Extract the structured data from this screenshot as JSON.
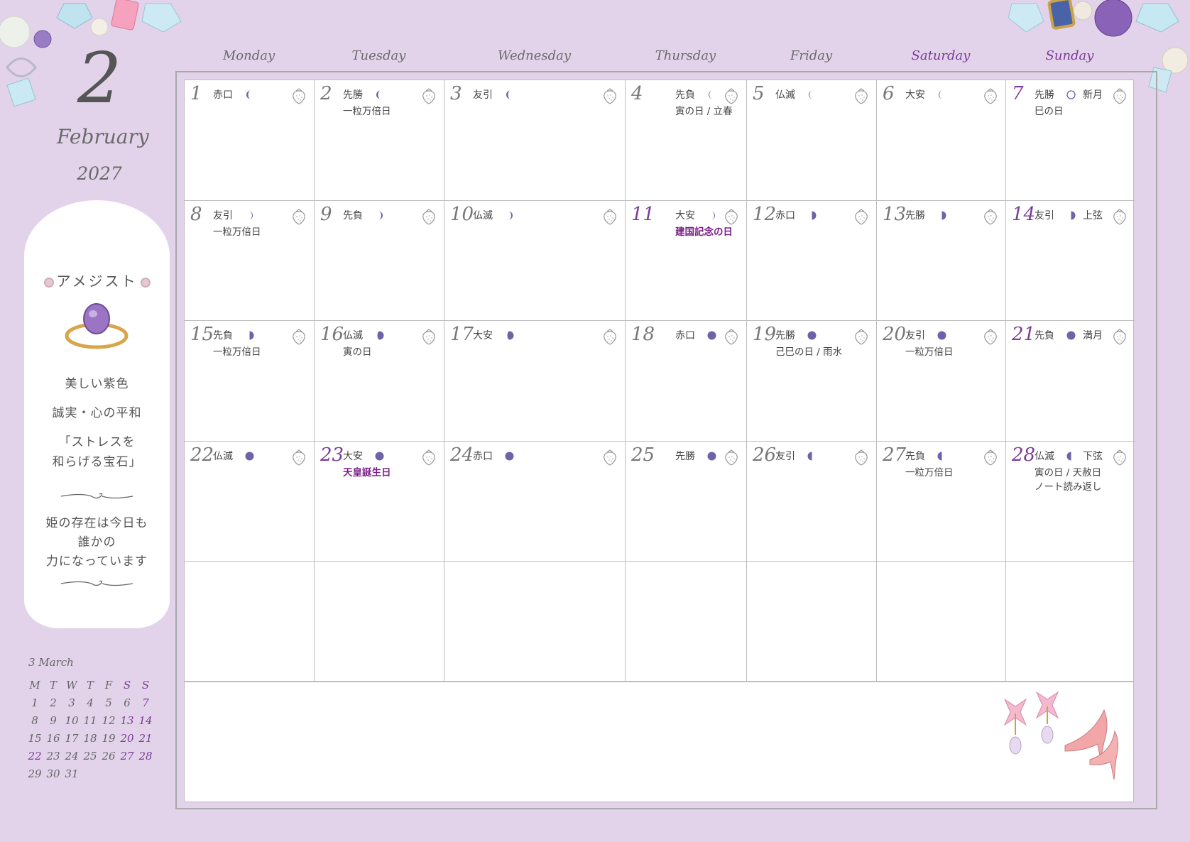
{
  "month": {
    "number": "2",
    "name": "February",
    "year": "2027"
  },
  "weekdays": [
    "Monday",
    "Tuesday",
    "Wednesday",
    "Thursday",
    "Friday",
    "Saturday",
    "Sunday"
  ],
  "gem": {
    "name": "アメジスト",
    "lines": [
      "美しい紫色",
      "誠実・心の平和",
      "「ストレスを",
      "和らげる宝石」"
    ],
    "message": [
      "姫の存在は今日も",
      "誰かの",
      "力になっています"
    ]
  },
  "mini_calendar": {
    "title": "3 March",
    "headers": [
      "M",
      "T",
      "W",
      "T",
      "F",
      "S",
      "S"
    ],
    "rows": [
      [
        "1",
        "2",
        "3",
        "4",
        "5",
        "6",
        "7"
      ],
      [
        "8",
        "9",
        "10",
        "11",
        "12",
        "13",
        "14"
      ],
      [
        "15",
        "16",
        "17",
        "18",
        "19",
        "20",
        "21"
      ],
      [
        "22",
        "23",
        "24",
        "25",
        "26",
        "27",
        "28"
      ],
      [
        "29",
        "30",
        "31",
        "",
        "",
        "",
        "",
        ""
      ]
    ],
    "purple_cells": [
      "7",
      "13",
      "14",
      "20",
      "21",
      "22",
      "27",
      "28"
    ]
  },
  "days": [
    {
      "d": "1",
      "rokuyo": "赤口",
      "moon": "crescent-waxing",
      "phase": "",
      "notes": []
    },
    {
      "d": "2",
      "rokuyo": "先勝",
      "moon": "crescent-waxing",
      "phase": "",
      "notes": [
        "一粒万倍日"
      ]
    },
    {
      "d": "3",
      "rokuyo": "友引",
      "moon": "crescent-waxing",
      "phase": "",
      "notes": []
    },
    {
      "d": "4",
      "rokuyo": "先負",
      "moon": "crescent-thin",
      "phase": "",
      "notes": [
        "寅の日 / 立春"
      ]
    },
    {
      "d": "5",
      "rokuyo": "仏滅",
      "moon": "crescent-thin",
      "phase": "",
      "notes": []
    },
    {
      "d": "6",
      "rokuyo": "大安",
      "moon": "crescent-thin",
      "phase": "",
      "notes": []
    },
    {
      "d": "7",
      "rokuyo": "先勝",
      "moon": "new",
      "phase": "新月",
      "notes": [
        "巳の日"
      ],
      "sun": true
    },
    {
      "d": "8",
      "rokuyo": "友引",
      "moon": "thin-right",
      "phase": "",
      "notes": [
        "一粒万倍日"
      ]
    },
    {
      "d": "9",
      "rokuyo": "先負",
      "moon": "crescent-right",
      "phase": "",
      "notes": []
    },
    {
      "d": "10",
      "rokuyo": "仏滅",
      "moon": "crescent-right",
      "phase": "",
      "notes": []
    },
    {
      "d": "11",
      "rokuyo": "大安",
      "moon": "crescent-right-thin",
      "phase": "",
      "notes": [
        "建国記念の日"
      ],
      "hol": true
    },
    {
      "d": "12",
      "rokuyo": "赤口",
      "moon": "half-right",
      "phase": "",
      "notes": []
    },
    {
      "d": "13",
      "rokuyo": "先勝",
      "moon": "half-right",
      "phase": "",
      "notes": []
    },
    {
      "d": "14",
      "rokuyo": "友引",
      "moon": "half-right",
      "phase": "上弦",
      "notes": [],
      "sun": true
    },
    {
      "d": "15",
      "rokuyo": "先負",
      "moon": "half-right",
      "phase": "",
      "notes": [
        "一粒万倍日"
      ]
    },
    {
      "d": "16",
      "rokuyo": "仏滅",
      "moon": "gibbous",
      "phase": "",
      "notes": [
        "寅の日"
      ]
    },
    {
      "d": "17",
      "rokuyo": "大安",
      "moon": "gibbous",
      "phase": "",
      "notes": []
    },
    {
      "d": "18",
      "rokuyo": "赤口",
      "moon": "full",
      "phase": "",
      "notes": []
    },
    {
      "d": "19",
      "rokuyo": "先勝",
      "moon": "full",
      "phase": "",
      "notes": [
        "己巳の日 / 雨水"
      ]
    },
    {
      "d": "20",
      "rokuyo": "友引",
      "moon": "full",
      "phase": "",
      "notes": [
        "一粒万倍日"
      ]
    },
    {
      "d": "21",
      "rokuyo": "先負",
      "moon": "full",
      "phase": "満月",
      "notes": [],
      "sun": true
    },
    {
      "d": "22",
      "rokuyo": "仏滅",
      "moon": "full",
      "phase": "",
      "notes": []
    },
    {
      "d": "23",
      "rokuyo": "大安",
      "moon": "full",
      "phase": "",
      "notes": [
        "天皇誕生日"
      ],
      "hol": true
    },
    {
      "d": "24",
      "rokuyo": "赤口",
      "moon": "full",
      "phase": "",
      "notes": []
    },
    {
      "d": "25",
      "rokuyo": "先勝",
      "moon": "full",
      "phase": "",
      "notes": []
    },
    {
      "d": "26",
      "rokuyo": "友引",
      "moon": "half-left",
      "phase": "",
      "notes": []
    },
    {
      "d": "27",
      "rokuyo": "先負",
      "moon": "half-left",
      "phase": "",
      "notes": [
        "一粒万倍日"
      ]
    },
    {
      "d": "28",
      "rokuyo": "仏滅",
      "moon": "half-left",
      "phase": "下弦",
      "notes": [
        "寅の日 / 天赦日",
        "ノート読み返し"
      ],
      "sun": true
    }
  ],
  "colors": {
    "background": "#e2d3ea",
    "accent": "#7b3b96",
    "moon": "#6f63a8"
  }
}
